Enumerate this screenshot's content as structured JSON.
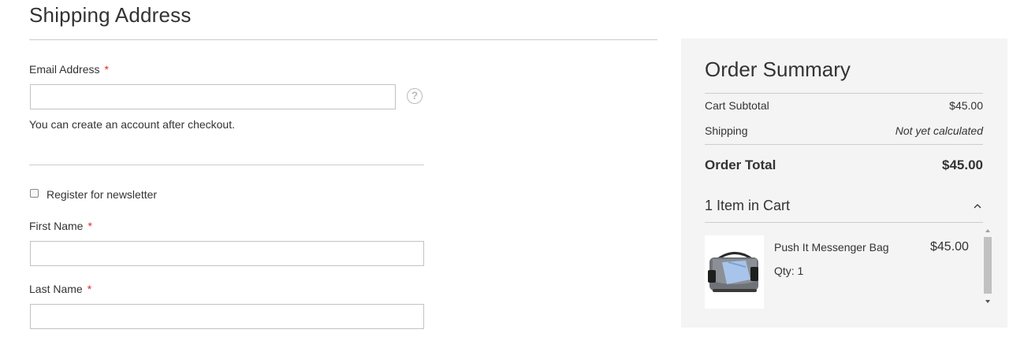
{
  "shipping": {
    "title": "Shipping Address",
    "email": {
      "label": "Email Address",
      "required_mark": "*",
      "value": "",
      "placeholder": ""
    },
    "account_note": "You can create an account after checkout.",
    "newsletter": {
      "label": "Register for newsletter",
      "checked": false
    },
    "first_name": {
      "label": "First Name",
      "required_mark": "*",
      "value": "",
      "placeholder": ""
    },
    "last_name": {
      "label": "Last Name",
      "required_mark": "*",
      "value": "",
      "placeholder": ""
    },
    "help_icon": "?"
  },
  "summary": {
    "title": "Order Summary",
    "subtotal": {
      "label": "Cart Subtotal",
      "value": "$45.00"
    },
    "shipping": {
      "label": "Shipping",
      "value": "Not yet calculated"
    },
    "total": {
      "label": "Order Total",
      "value": "$45.00"
    },
    "items_title": "1 Item in Cart",
    "items": [
      {
        "name": "Push It Messenger Bag",
        "price": "$45.00",
        "qty_label": "Qty: 1"
      }
    ]
  },
  "colors": {
    "required": "#e02b27",
    "summary_bg": "#f4f4f4",
    "border": "#cccccc"
  },
  "icons": [
    "help-icon",
    "chevron-up-icon",
    "scroll-up-arrow-icon",
    "scroll-down-arrow-icon"
  ]
}
